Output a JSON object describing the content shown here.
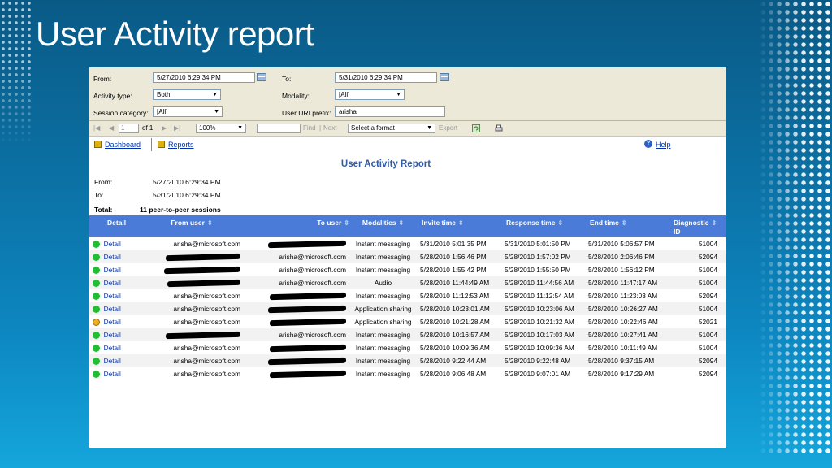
{
  "slide": {
    "title": "User Activity report"
  },
  "params": {
    "from_label": "From:",
    "from_value": "5/27/2010 6:29:34 PM",
    "to_label": "To:",
    "to_value": "5/31/2010 6:29:34 PM",
    "activity_type_label": "Activity type:",
    "activity_type_value": "Both",
    "modality_label": "Modality:",
    "modality_value": "[All]",
    "session_category_label": "Session category:",
    "session_category_value": "[All]",
    "user_uri_label": "User URI prefix:",
    "user_uri_value": "arisha"
  },
  "toolbar": {
    "page_input": "1",
    "page_of": "of 1",
    "zoom": "100%",
    "find_label": "Find",
    "sep": "|",
    "next_label": "Next",
    "format_select": "Select a format",
    "export_label": "Export"
  },
  "nav": {
    "dashboard": "Dashboard",
    "reports": "Reports",
    "help": "Help"
  },
  "report": {
    "title": "User Activity Report",
    "from_label": "From:",
    "from_value": "5/27/2010 6:29:34 PM",
    "to_label": "To:",
    "to_value": "5/31/2010 6:29:34 PM",
    "total_label": "Total:",
    "total_value": "11 peer-to-peer sessions"
  },
  "columns": {
    "detail": "Detail",
    "from_user": "From user",
    "to_user": "To user",
    "modalities": "Modalities",
    "invite_time": "Invite time",
    "response_time": "Response time",
    "end_time": "End time",
    "diagnostic_id_1": "Diagnostic",
    "diagnostic_id_2": "ID"
  },
  "rows": [
    {
      "status": "ok",
      "detail": "Detail",
      "from": "arisha@microsoft.com",
      "to": "",
      "mod": "Instant messaging",
      "invite": "5/31/2010 5:01:35 PM",
      "resp": "5/31/2010 5:01:50 PM",
      "end": "5/31/2010 5:06:57 PM",
      "diag": "51004"
    },
    {
      "status": "ok",
      "detail": "Detail",
      "from": "",
      "to": "arisha@microsoft.com",
      "mod": "Instant messaging",
      "invite": "5/28/2010 1:56:46 PM",
      "resp": "5/28/2010 1:57:02 PM",
      "end": "5/28/2010 2:06:46 PM",
      "diag": "52094"
    },
    {
      "status": "ok",
      "detail": "Detail",
      "from": "",
      "to": "arisha@microsoft.com",
      "mod": "Instant messaging",
      "invite": "5/28/2010 1:55:42 PM",
      "resp": "5/28/2010 1:55:50 PM",
      "end": "5/28/2010 1:56:12 PM",
      "diag": "51004"
    },
    {
      "status": "ok",
      "detail": "Detail",
      "from": "",
      "to": "arisha@microsoft.com",
      "mod": "Audio",
      "invite": "5/28/2010 11:44:49 AM",
      "resp": "5/28/2010 11:44:56 AM",
      "end": "5/28/2010 11:47:17 AM",
      "diag": "51004"
    },
    {
      "status": "ok",
      "detail": "Detail",
      "from": "arisha@microsoft.com",
      "to": "",
      "mod": "Instant messaging",
      "invite": "5/28/2010 11:12:53 AM",
      "resp": "5/28/2010 11:12:54 AM",
      "end": "5/28/2010 11:23:03 AM",
      "diag": "52094"
    },
    {
      "status": "ok",
      "detail": "Detail",
      "from": "arisha@microsoft.com",
      "to": "",
      "mod": "Application sharing",
      "invite": "5/28/2010 10:23:01 AM",
      "resp": "5/28/2010 10:23:06 AM",
      "end": "5/28/2010 10:26:27 AM",
      "diag": "51004"
    },
    {
      "status": "warn",
      "detail": "Detail",
      "from": "arisha@microsoft.com",
      "to": "",
      "mod": "Application sharing",
      "invite": "5/28/2010 10:21:28 AM",
      "resp": "5/28/2010 10:21:32 AM",
      "end": "5/28/2010 10:22:46 AM",
      "diag": "52021"
    },
    {
      "status": "ok",
      "detail": "Detail",
      "from": "",
      "to": "arisha@microsoft.com",
      "mod": "Instant messaging",
      "invite": "5/28/2010 10:16:57 AM",
      "resp": "5/28/2010 10:17:03 AM",
      "end": "5/28/2010 10:27:41 AM",
      "diag": "51004"
    },
    {
      "status": "ok",
      "detail": "Detail",
      "from": "arisha@microsoft.com",
      "to": "",
      "mod": "Instant messaging",
      "invite": "5/28/2010 10:09:36 AM",
      "resp": "5/28/2010 10:09:36 AM",
      "end": "5/28/2010 10:11:49 AM",
      "diag": "51004"
    },
    {
      "status": "ok",
      "detail": "Detail",
      "from": "arisha@microsoft.com",
      "to": "",
      "mod": "Instant messaging",
      "invite": "5/28/2010 9:22:44 AM",
      "resp": "5/28/2010 9:22:48 AM",
      "end": "5/28/2010 9:37:15 AM",
      "diag": "52094"
    },
    {
      "status": "ok",
      "detail": "Detail",
      "from": "arisha@microsoft.com",
      "to": "",
      "mod": "Instant messaging",
      "invite": "5/28/2010 9:06:48 AM",
      "resp": "5/28/2010 9:07:01 AM",
      "end": "5/28/2010 9:17:29 AM",
      "diag": "52094"
    }
  ]
}
